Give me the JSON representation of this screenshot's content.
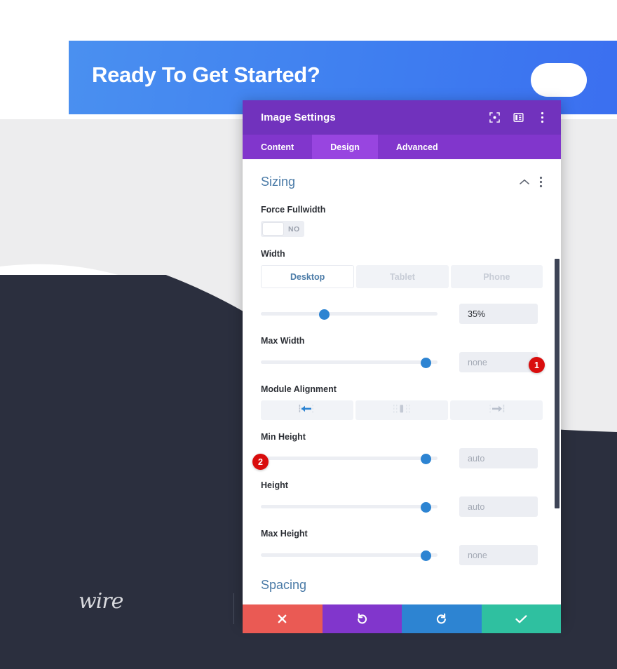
{
  "background": {
    "hero_title": "Ready To Get Started?",
    "logo_text": "wire",
    "colors": {
      "hero_gradient_start": "#4a90f0",
      "hero_gradient_end": "#3b6ff0",
      "grey_band": "#ededee",
      "navy": "#2b2f3e"
    }
  },
  "modal": {
    "title": "Image Settings",
    "header_icons": [
      {
        "name": "fullscreen-icon"
      },
      {
        "name": "panel-layout-icon"
      },
      {
        "name": "more-options-icon"
      }
    ],
    "tabs": [
      {
        "label": "Content",
        "active": false
      },
      {
        "label": "Design",
        "active": true
      },
      {
        "label": "Advanced",
        "active": false
      }
    ],
    "section": {
      "title": "Sizing",
      "collapse_icon": "chevron-up-icon",
      "menu_icon": "more-options-icon"
    },
    "fields": {
      "force_fullwidth": {
        "label": "Force Fullwidth",
        "toggle_value": "NO"
      },
      "width": {
        "label": "Width",
        "devices": [
          {
            "label": "Desktop",
            "active": true
          },
          {
            "label": "Tablet",
            "active": false
          },
          {
            "label": "Phone",
            "active": false
          }
        ],
        "slider_percent": 35,
        "value": "35%",
        "value_is_placeholder": false
      },
      "max_width": {
        "label": "Max Width",
        "slider_percent": 96,
        "value": "none",
        "value_is_placeholder": true
      },
      "module_alignment": {
        "label": "Module Alignment",
        "options": [
          {
            "name": "align-left-icon",
            "active": true
          },
          {
            "name": "align-center-icon",
            "active": false
          },
          {
            "name": "align-right-icon",
            "active": false
          }
        ]
      },
      "min_height": {
        "label": "Min Height",
        "slider_percent": 96,
        "value": "auto",
        "value_is_placeholder": true
      },
      "height": {
        "label": "Height",
        "slider_percent": 96,
        "value": "auto",
        "value_is_placeholder": true
      },
      "max_height": {
        "label": "Max Height",
        "slider_percent": 96,
        "value": "none",
        "value_is_placeholder": true
      },
      "next_section_partial": "Spacing"
    },
    "footer_buttons": [
      {
        "name": "cancel-button",
        "icon": "close-icon",
        "color": "#ea5a54"
      },
      {
        "name": "undo-button",
        "icon": "undo-icon",
        "color": "#8136cc"
      },
      {
        "name": "redo-button",
        "icon": "redo-icon",
        "color": "#2d84d2"
      },
      {
        "name": "save-button",
        "icon": "check-icon",
        "color": "#2fc0a0"
      }
    ]
  },
  "annotations": [
    {
      "id": "1",
      "label": "1"
    },
    {
      "id": "2",
      "label": "2"
    }
  ]
}
